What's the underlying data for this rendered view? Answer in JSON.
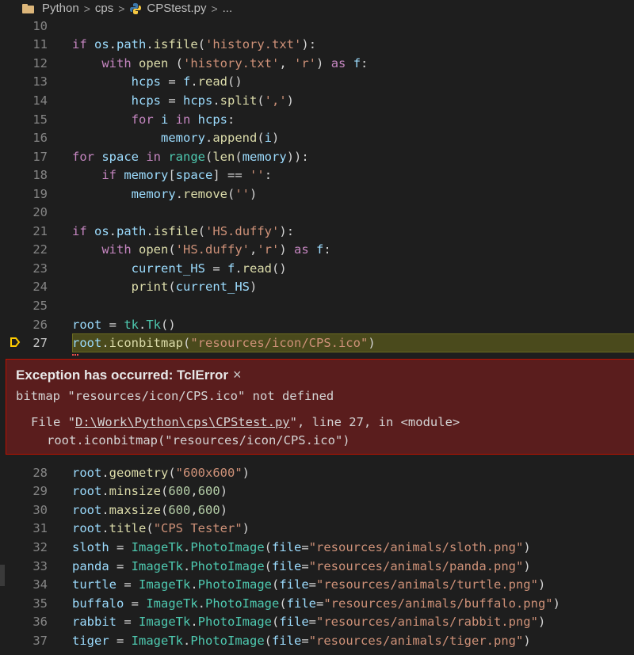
{
  "breadcrumb": {
    "items": [
      "Python",
      "cps",
      "CPStest.py",
      "..."
    ],
    "separator": ">"
  },
  "code_top": [
    {
      "num": "10",
      "segs": []
    },
    {
      "num": "11",
      "segs": [
        [
          "k",
          "if "
        ],
        [
          "v",
          "os"
        ],
        [
          "p",
          "."
        ],
        [
          "v",
          "path"
        ],
        [
          "p",
          "."
        ],
        [
          "fn",
          "isfile"
        ],
        [
          "p",
          "("
        ],
        [
          "s",
          "'history.txt'"
        ],
        [
          "p",
          "):"
        ]
      ]
    },
    {
      "num": "12",
      "segs": [
        [
          "p",
          "    "
        ],
        [
          "k",
          "with "
        ],
        [
          "fn",
          "open "
        ],
        [
          "p",
          "("
        ],
        [
          "s",
          "'history.txt'"
        ],
        [
          "p",
          ", "
        ],
        [
          "s",
          "'r'"
        ],
        [
          "p",
          ") "
        ],
        [
          "k",
          "as "
        ],
        [
          "v",
          "f"
        ],
        [
          "p",
          ":"
        ]
      ]
    },
    {
      "num": "13",
      "segs": [
        [
          "p",
          "        "
        ],
        [
          "v",
          "hcps"
        ],
        [
          "p",
          " = "
        ],
        [
          "v",
          "f"
        ],
        [
          "p",
          "."
        ],
        [
          "fn",
          "read"
        ],
        [
          "p",
          "()"
        ]
      ]
    },
    {
      "num": "14",
      "segs": [
        [
          "p",
          "        "
        ],
        [
          "v",
          "hcps"
        ],
        [
          "p",
          " = "
        ],
        [
          "v",
          "hcps"
        ],
        [
          "p",
          "."
        ],
        [
          "fn",
          "split"
        ],
        [
          "p",
          "("
        ],
        [
          "s",
          "','"
        ],
        [
          "p",
          ")"
        ]
      ]
    },
    {
      "num": "15",
      "segs": [
        [
          "p",
          "        "
        ],
        [
          "k",
          "for "
        ],
        [
          "v",
          "i "
        ],
        [
          "k",
          "in "
        ],
        [
          "v",
          "hcps"
        ],
        [
          "p",
          ":"
        ]
      ]
    },
    {
      "num": "16",
      "segs": [
        [
          "p",
          "            "
        ],
        [
          "v",
          "memory"
        ],
        [
          "p",
          "."
        ],
        [
          "fn",
          "append"
        ],
        [
          "p",
          "("
        ],
        [
          "v",
          "i"
        ],
        [
          "p",
          ")"
        ]
      ]
    },
    {
      "num": "17",
      "segs": [
        [
          "k",
          "for "
        ],
        [
          "v",
          "space "
        ],
        [
          "k",
          "in "
        ],
        [
          "cls",
          "range"
        ],
        [
          "p",
          "("
        ],
        [
          "fn",
          "len"
        ],
        [
          "p",
          "("
        ],
        [
          "v",
          "memory"
        ],
        [
          "p",
          "))"
        ],
        [
          "p",
          ":"
        ]
      ]
    },
    {
      "num": "18",
      "segs": [
        [
          "p",
          "    "
        ],
        [
          "k",
          "if "
        ],
        [
          "v",
          "memory"
        ],
        [
          "p",
          "["
        ],
        [
          "v",
          "space"
        ],
        [
          "p",
          "] == "
        ],
        [
          "s",
          "''"
        ],
        [
          "p",
          ":"
        ]
      ]
    },
    {
      "num": "19",
      "segs": [
        [
          "p",
          "        "
        ],
        [
          "v",
          "memory"
        ],
        [
          "p",
          "."
        ],
        [
          "fn",
          "remove"
        ],
        [
          "p",
          "("
        ],
        [
          "s",
          "''"
        ],
        [
          "p",
          ")"
        ]
      ]
    },
    {
      "num": "20",
      "segs": []
    },
    {
      "num": "21",
      "segs": [
        [
          "k",
          "if "
        ],
        [
          "v",
          "os"
        ],
        [
          "p",
          "."
        ],
        [
          "v",
          "path"
        ],
        [
          "p",
          "."
        ],
        [
          "fn",
          "isfile"
        ],
        [
          "p",
          "("
        ],
        [
          "s",
          "'HS.duffy'"
        ],
        [
          "p",
          "):"
        ]
      ]
    },
    {
      "num": "22",
      "segs": [
        [
          "p",
          "    "
        ],
        [
          "k",
          "with "
        ],
        [
          "fn",
          "open"
        ],
        [
          "p",
          "("
        ],
        [
          "s",
          "'HS.duffy'"
        ],
        [
          "p",
          ","
        ],
        [
          "s",
          "'r'"
        ],
        [
          "p",
          ") "
        ],
        [
          "k",
          "as "
        ],
        [
          "v",
          "f"
        ],
        [
          "p",
          ":"
        ]
      ]
    },
    {
      "num": "23",
      "segs": [
        [
          "p",
          "        "
        ],
        [
          "v",
          "current_HS"
        ],
        [
          "p",
          " = "
        ],
        [
          "v",
          "f"
        ],
        [
          "p",
          "."
        ],
        [
          "fn",
          "read"
        ],
        [
          "p",
          "()"
        ]
      ]
    },
    {
      "num": "24",
      "segs": [
        [
          "p",
          "        "
        ],
        [
          "fn",
          "print"
        ],
        [
          "p",
          "("
        ],
        [
          "v",
          "current_HS"
        ],
        [
          "p",
          ")"
        ]
      ]
    },
    {
      "num": "25",
      "segs": []
    },
    {
      "num": "26",
      "segs": [
        [
          "v",
          "root"
        ],
        [
          "p",
          " = "
        ],
        [
          "cls",
          "tk"
        ],
        [
          "p",
          "."
        ],
        [
          "cls",
          "Tk"
        ],
        [
          "p",
          "()"
        ]
      ]
    },
    {
      "num": "27",
      "segs": [
        [
          "v",
          "root"
        ],
        [
          "p",
          "."
        ],
        [
          "fn",
          "iconbitmap"
        ],
        [
          "p",
          "("
        ],
        [
          "s",
          "\"resources/icon/CPS.ico\""
        ],
        [
          "p",
          ")"
        ]
      ],
      "active": true
    }
  ],
  "code_bottom": [
    {
      "num": "28",
      "segs": [
        [
          "v",
          "root"
        ],
        [
          "p",
          "."
        ],
        [
          "fn",
          "geometry"
        ],
        [
          "p",
          "("
        ],
        [
          "s",
          "\"600x600\""
        ],
        [
          "p",
          ")"
        ]
      ]
    },
    {
      "num": "29",
      "segs": [
        [
          "v",
          "root"
        ],
        [
          "p",
          "."
        ],
        [
          "fn",
          "minsize"
        ],
        [
          "p",
          "("
        ],
        [
          "n",
          "600"
        ],
        [
          "p",
          ","
        ],
        [
          "n",
          "600"
        ],
        [
          "p",
          ")"
        ]
      ]
    },
    {
      "num": "30",
      "segs": [
        [
          "v",
          "root"
        ],
        [
          "p",
          "."
        ],
        [
          "fn",
          "maxsize"
        ],
        [
          "p",
          "("
        ],
        [
          "n",
          "600"
        ],
        [
          "p",
          ","
        ],
        [
          "n",
          "600"
        ],
        [
          "p",
          ")"
        ]
      ]
    },
    {
      "num": "31",
      "segs": [
        [
          "v",
          "root"
        ],
        [
          "p",
          "."
        ],
        [
          "fn",
          "title"
        ],
        [
          "p",
          "("
        ],
        [
          "s",
          "\"CPS Tester\""
        ],
        [
          "p",
          ")"
        ]
      ]
    },
    {
      "num": "32",
      "segs": [
        [
          "v",
          "sloth"
        ],
        [
          "p",
          " = "
        ],
        [
          "cls",
          "ImageTk"
        ],
        [
          "p",
          "."
        ],
        [
          "cls",
          "PhotoImage"
        ],
        [
          "p",
          "("
        ],
        [
          "v",
          "file"
        ],
        [
          "p",
          "="
        ],
        [
          "s",
          "\"resources/animals/sloth.png\""
        ],
        [
          "p",
          ")"
        ]
      ]
    },
    {
      "num": "33",
      "segs": [
        [
          "v",
          "panda"
        ],
        [
          "p",
          " = "
        ],
        [
          "cls",
          "ImageTk"
        ],
        [
          "p",
          "."
        ],
        [
          "cls",
          "PhotoImage"
        ],
        [
          "p",
          "("
        ],
        [
          "v",
          "file"
        ],
        [
          "p",
          "="
        ],
        [
          "s",
          "\"resources/animals/panda.png\""
        ],
        [
          "p",
          ")"
        ]
      ]
    },
    {
      "num": "34",
      "segs": [
        [
          "v",
          "turtle"
        ],
        [
          "p",
          " = "
        ],
        [
          "cls",
          "ImageTk"
        ],
        [
          "p",
          "."
        ],
        [
          "cls",
          "PhotoImage"
        ],
        [
          "p",
          "("
        ],
        [
          "v",
          "file"
        ],
        [
          "p",
          "="
        ],
        [
          "s",
          "\"resources/animals/turtle.png\""
        ],
        [
          "p",
          ")"
        ]
      ]
    },
    {
      "num": "35",
      "segs": [
        [
          "v",
          "buffalo"
        ],
        [
          "p",
          " = "
        ],
        [
          "cls",
          "ImageTk"
        ],
        [
          "p",
          "."
        ],
        [
          "cls",
          "PhotoImage"
        ],
        [
          "p",
          "("
        ],
        [
          "v",
          "file"
        ],
        [
          "p",
          "="
        ],
        [
          "s",
          "\"resources/animals/buffalo.png\""
        ],
        [
          "p",
          ")"
        ]
      ]
    },
    {
      "num": "36",
      "segs": [
        [
          "v",
          "rabbit"
        ],
        [
          "p",
          " = "
        ],
        [
          "cls",
          "ImageTk"
        ],
        [
          "p",
          "."
        ],
        [
          "cls",
          "PhotoImage"
        ],
        [
          "p",
          "("
        ],
        [
          "v",
          "file"
        ],
        [
          "p",
          "="
        ],
        [
          "s",
          "\"resources/animals/rabbit.png\""
        ],
        [
          "p",
          ")"
        ]
      ]
    },
    {
      "num": "37",
      "segs": [
        [
          "v",
          "tiger"
        ],
        [
          "p",
          " = "
        ],
        [
          "cls",
          "ImageTk"
        ],
        [
          "p",
          "."
        ],
        [
          "cls",
          "PhotoImage"
        ],
        [
          "p",
          "("
        ],
        [
          "v",
          "file"
        ],
        [
          "p",
          "="
        ],
        [
          "s",
          "\"resources/animals/tiger.png\""
        ],
        [
          "p",
          ")"
        ]
      ]
    }
  ],
  "exception": {
    "title": "Exception has occurred: TclError",
    "close": "×",
    "message": "bitmap \"resources/icon/CPS.ico\" not defined",
    "file_prefix": "File \"",
    "file_path": "D:\\Work\\Python\\cps\\CPStest.py",
    "file_suffix": "\", line 27, in <module>",
    "code_line": "root.iconbitmap(\"resources/icon/CPS.ico\")"
  },
  "colors": {
    "background": "#1e1e1e",
    "exception_bg": "#5a1d1d",
    "highlight": "#4b4b18",
    "breakpoint": "#ffcc00"
  }
}
